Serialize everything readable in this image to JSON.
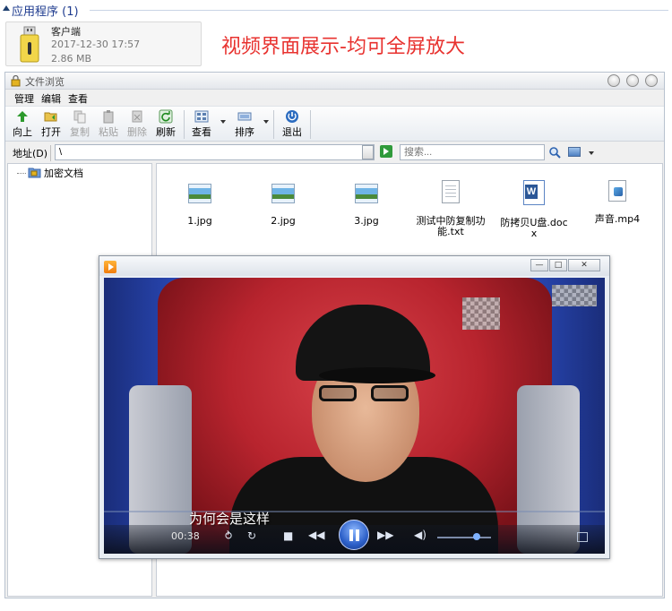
{
  "section": {
    "title": "应用程序 (1)"
  },
  "app": {
    "name": "客户端",
    "date": "2017-12-30 17:57",
    "size": "2.86 MB"
  },
  "headline": "视频界面展示-均可全屏放大",
  "file_window": {
    "title": "文件浏览",
    "menu": [
      "管理",
      "编辑",
      "查看"
    ],
    "toolbar": {
      "up": "向上",
      "open": "打开",
      "copy": "复制",
      "paste": "粘贴",
      "delete": "删除",
      "refresh": "刷新",
      "view": "查看",
      "sort": "排序",
      "exit": "退出"
    },
    "address": {
      "label": "地址(D)",
      "value": "\\"
    },
    "search": {
      "placeholder": "搜索..."
    },
    "tree": {
      "root": "加密文档"
    },
    "files": [
      {
        "name": "1.jpg",
        "icon": "image-file-icon"
      },
      {
        "name": "2.jpg",
        "icon": "image-file-icon"
      },
      {
        "name": "3.jpg",
        "icon": "image-file-icon"
      },
      {
        "name": "测试中防复制功能.txt",
        "icon": "text-file-icon"
      },
      {
        "name": "防拷贝U盘.docx",
        "icon": "word-file-icon"
      },
      {
        "name": "声音.mp4",
        "icon": "video-file-icon"
      }
    ]
  },
  "player": {
    "subtitle": "为何会是这样",
    "time": "00:38",
    "window_buttons": [
      "minimize",
      "maximize",
      "close"
    ],
    "volume_level": 0.65
  },
  "colors": {
    "headline": "#e8322f",
    "section_title": "#1e3b8f",
    "play_button": "#2c5fc8"
  }
}
